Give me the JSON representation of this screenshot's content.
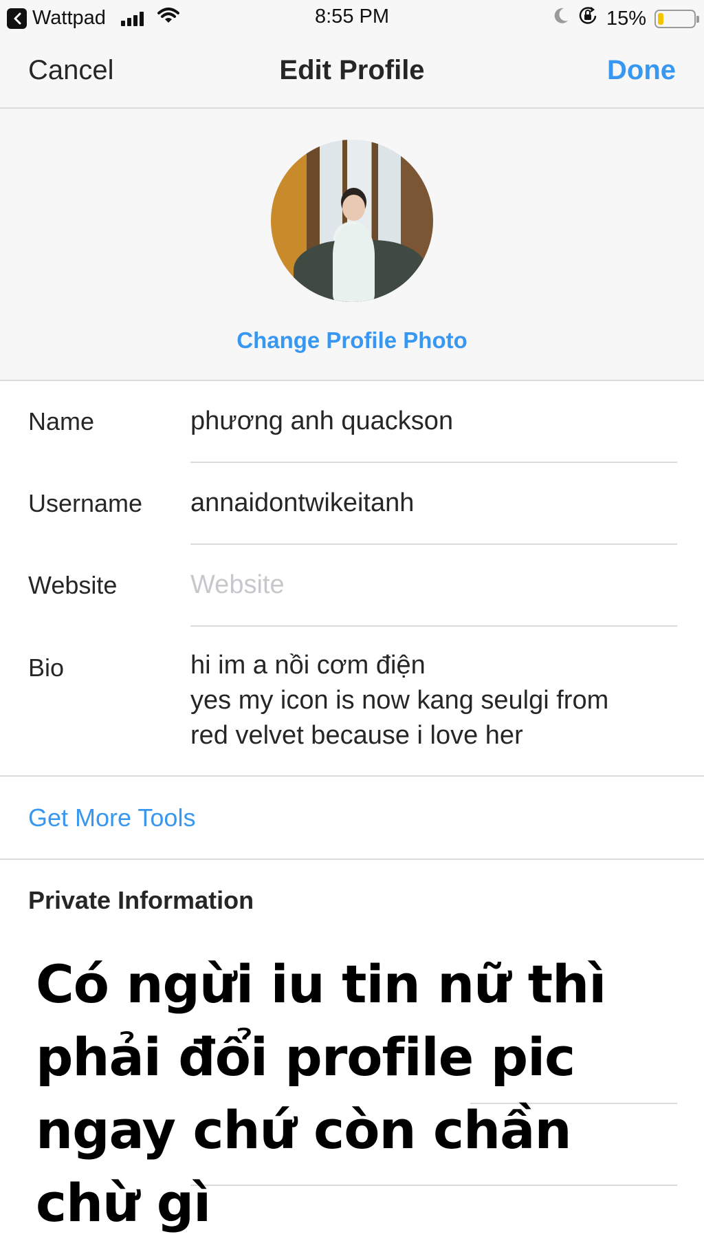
{
  "status_bar": {
    "back_app_label": "Wattpad",
    "time": "8:55 PM",
    "battery_percent": "15%",
    "battery_level": 0.15
  },
  "nav": {
    "cancel_label": "Cancel",
    "title": "Edit Profile",
    "done_label": "Done"
  },
  "photo": {
    "change_label": "Change Profile Photo"
  },
  "form": {
    "name_label": "Name",
    "name_value": "phương anh quackson",
    "username_label": "Username",
    "username_value": "annaidontwikeitanh",
    "website_label": "Website",
    "website_value": "",
    "website_placeholder": "Website",
    "bio_label": "Bio",
    "bio_value": "hi im a nồi cơm điện\nyes my icon is now kang seulgi from\nred velvet because i love her"
  },
  "tools": {
    "get_more_tools_label": "Get More Tools"
  },
  "private_section": {
    "title": "Private Information"
  },
  "caption": {
    "text": "Có ngừi iu tin nữ thì phải đổi profile pic ngay chứ còn chần chừ gì"
  },
  "colors": {
    "accent": "#3897f0",
    "divider": "#dbdbdb",
    "header_bg": "#f7f7f7",
    "battery": "#f5c400"
  }
}
